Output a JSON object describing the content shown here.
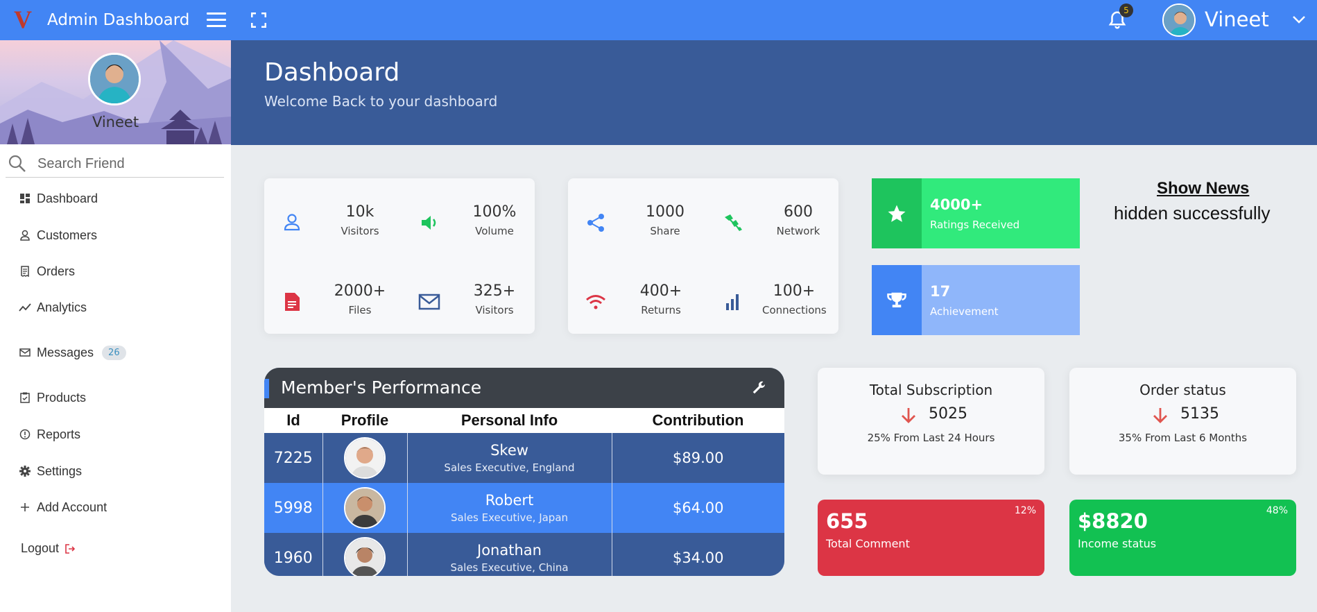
{
  "topbar": {
    "logo_letter": "V",
    "title": "Admin Dashboard",
    "notification_count": "5",
    "user_name": "Vineet"
  },
  "sidebar": {
    "profile_name": "Vineet",
    "search_placeholder": "Search Friend",
    "items": [
      {
        "label": "Dashboard",
        "icon": "dashboard-icon"
      },
      {
        "label": "Customers",
        "icon": "user-icon"
      },
      {
        "label": "Orders",
        "icon": "receipt-icon"
      },
      {
        "label": "Analytics",
        "icon": "trend-icon"
      },
      {
        "label": "Messages",
        "icon": "mail-icon",
        "badge": "26"
      },
      {
        "label": "Products",
        "icon": "clipboard-check-icon"
      },
      {
        "label": "Reports",
        "icon": "info-circle-icon"
      },
      {
        "label": "Settings",
        "icon": "gear-icon"
      },
      {
        "label": "Add Account",
        "icon": "plus-icon"
      }
    ],
    "logout_label": "Logout"
  },
  "header": {
    "title": "Dashboard",
    "subtitle": "Welcome Back to your dashboard"
  },
  "stats_card_1": [
    {
      "value": "10k",
      "label": "Visitors",
      "icon": "user-icon"
    },
    {
      "value": "100%",
      "label": "Volume",
      "icon": "volume-icon"
    },
    {
      "value": "2000+",
      "label": "Files",
      "icon": "file-icon"
    },
    {
      "value": "325+",
      "label": "Visitors",
      "icon": "mail-icon"
    }
  ],
  "stats_card_2": [
    {
      "value": "1000",
      "label": "Share",
      "icon": "share-icon"
    },
    {
      "value": "600",
      "label": "Network",
      "icon": "network-icon"
    },
    {
      "value": "400+",
      "label": "Returns",
      "icon": "wifi-icon"
    },
    {
      "value": "100+",
      "label": "Connections",
      "icon": "bar-chart-icon"
    }
  ],
  "kpis": [
    {
      "value": "4000+",
      "label": "Ratings Received",
      "icon": "star-icon"
    },
    {
      "value": "17",
      "label": "Achievement",
      "icon": "trophy-icon"
    }
  ],
  "news": {
    "link": "Show News",
    "message": "hidden successfully"
  },
  "performance": {
    "title": "Member's Performance",
    "columns": [
      "Id",
      "Profile",
      "Personal Info",
      "Contribution"
    ],
    "rows": [
      {
        "id": "7225",
        "name": "Skew",
        "role": "Sales Executive, England",
        "contribution": "$89.00"
      },
      {
        "id": "5998",
        "name": "Robert",
        "role": "Sales Executive, Japan",
        "contribution": "$64.00"
      },
      {
        "id": "1960",
        "name": "Jonathan",
        "role": "Sales Executive, China",
        "contribution": "$34.00"
      }
    ]
  },
  "subscription": {
    "title": "Total Subscription",
    "value": "5025",
    "note": "25% From Last 24 Hours"
  },
  "order_status": {
    "title": "Order status",
    "value": "5135",
    "note": "35% From Last 6 Months"
  },
  "tiles": [
    {
      "value": "655",
      "label": "Total Comment",
      "percent": "12%",
      "color": "#dc3545"
    },
    {
      "value": "$8820",
      "label": "Income status",
      "percent": "48%",
      "color": "#12c152"
    }
  ],
  "colors": {
    "topbar": "#4285f4",
    "header": "#395b98",
    "green_dark": "#1ec45d",
    "green_light": "#31ea7c",
    "blue_dark": "#4285f4",
    "blue_light": "#8fb6fa"
  }
}
